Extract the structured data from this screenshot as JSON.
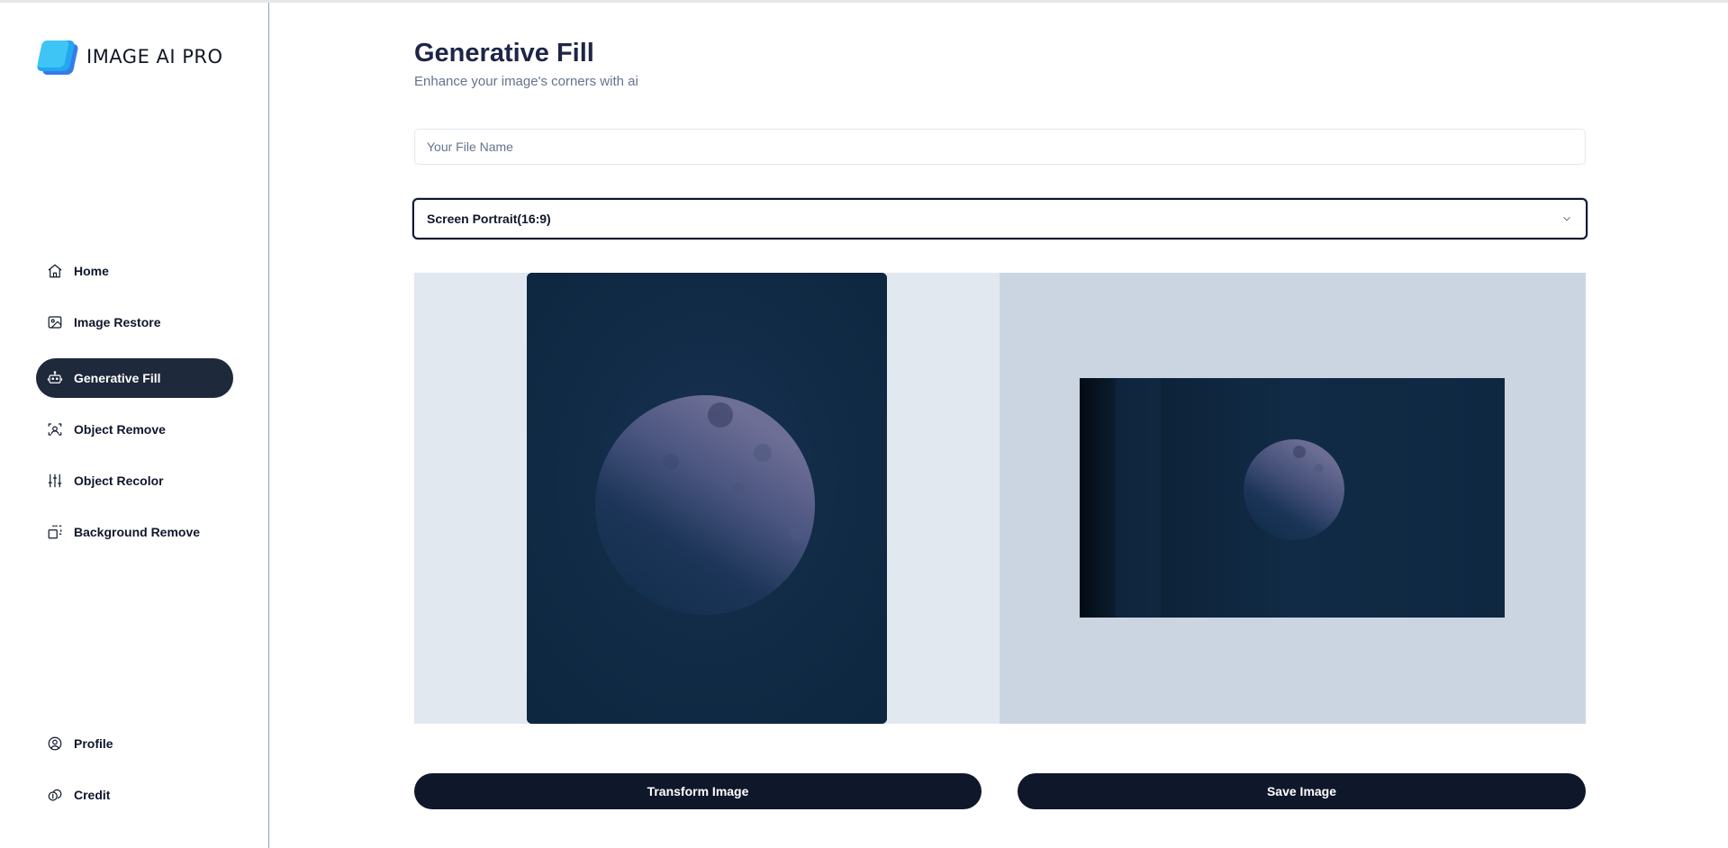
{
  "app": {
    "brand": "IMAGE AI PRO"
  },
  "sidebar": {
    "items": [
      {
        "label": "Home",
        "icon": "home-icon"
      },
      {
        "label": "Image Restore",
        "icon": "image-icon"
      },
      {
        "label": "Generative Fill",
        "icon": "robot-icon",
        "active": true
      },
      {
        "label": "Object Remove",
        "icon": "scan-icon"
      },
      {
        "label": "Object Recolor",
        "icon": "sliders-icon"
      },
      {
        "label": "Background Remove",
        "icon": "layers-dashed-icon"
      }
    ],
    "bottom": [
      {
        "label": "Profile",
        "icon": "user-circle-icon"
      },
      {
        "label": "Credit",
        "icon": "coins-icon"
      }
    ]
  },
  "main": {
    "title": "Generative Fill",
    "subtitle": "Enhance your image's corners with ai",
    "file_input": {
      "placeholder": "Your File Name",
      "value": ""
    },
    "aspect_select": {
      "selected": "Screen Portrait(16:9)"
    },
    "buttons": {
      "transform": "Transform Image",
      "save": "Save Image"
    }
  },
  "colors": {
    "accent_dark": "#0f172a",
    "active_nav": "#1e293b",
    "panel_left_bg": "#e2e8f0",
    "panel_right_bg": "#cbd5e1",
    "logo_blue": "#1463e8",
    "logo_cyan": "#22a7f0"
  }
}
